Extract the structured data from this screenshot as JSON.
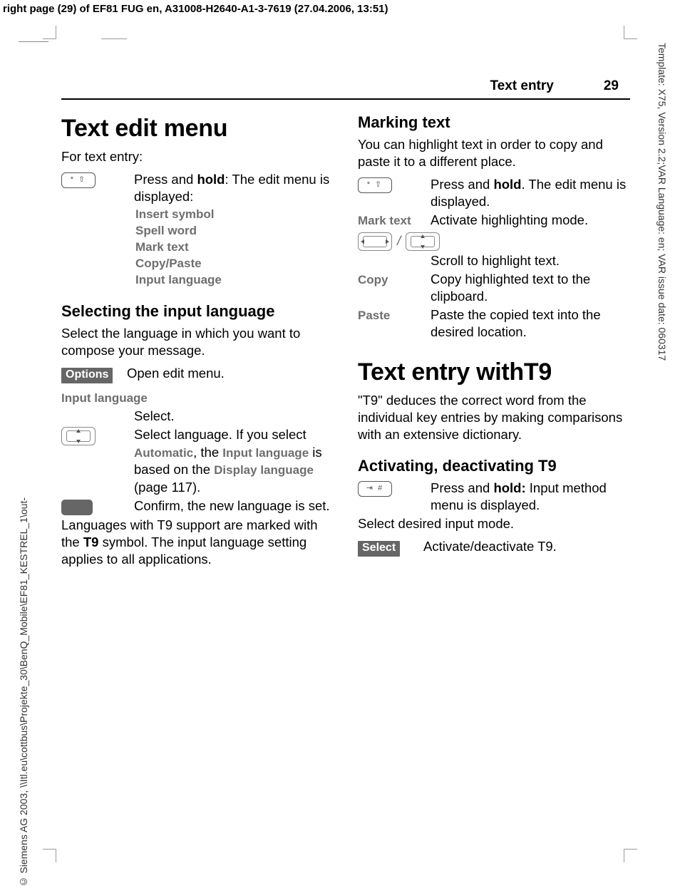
{
  "meta": {
    "top_header": "right page (29) of EF81 FUG en, A31008-H2640-A1-3-7619 (27.04.2006, 13:51)",
    "side_left": "© Siemens AG 2003, \\\\Itl.eu\\cottbus\\Projekte_30\\BenQ_Mobile\\EF81_KESTREL_1\\out-",
    "side_right": "Template: X75, Version 2.2;VAR Language: en; VAR issue date: 060317"
  },
  "running": {
    "section": "Text entry",
    "page": "29"
  },
  "left": {
    "h1": "Text edit menu",
    "intro": "For text entry:",
    "star_key": "*  ⇧",
    "press_hold_pre": "Press and ",
    "hold": "hold",
    "press_hold_post": ": The edit menu is displayed:",
    "menu": [
      "Insert symbol",
      "Spell word",
      "Mark text",
      "Copy/Paste",
      "Input language"
    ],
    "h2": "Selecting the input language",
    "select_lang": "Select the language in which you want to compose your message.",
    "options_softkey": "Options",
    "open_edit": "Open edit menu.",
    "input_lang_label": "Input language",
    "select": "Select.",
    "ud_desc_pre": "Select language. If you select ",
    "auto": "Automatic",
    "ud_desc_mid": ", the ",
    "il": "Input language",
    "ud_desc_mid2": " is based on the ",
    "dl": "Display language",
    "ud_desc_post": " (page 117).",
    "confirm": "Confirm, the new language is set.",
    "t9note_pre": "Languages with T9 support are marked with the ",
    "t9": "T9",
    "t9note_post": " symbol. The input language setting applies to all applications."
  },
  "right": {
    "h2a": "Marking text",
    "mark_intro": "You can highlight text in order to copy and paste it to a different place.",
    "star_key": "*  ⇧",
    "r_press_pre": "Press and ",
    "hold": "hold",
    "r_press_post": ". The edit menu is displayed.",
    "mark_text_label": "Mark text",
    "mark_text_desc": "Activate highlighting mode.",
    "scroll": "Scroll to highlight text.",
    "copy_label": "Copy",
    "copy_desc": "Copy highlighted text to the clipboard.",
    "paste_label": "Paste",
    "paste_desc": "Paste the copied text into the desired location.",
    "h1": "Text entry withT9",
    "t9_intro": "\"T9\" deduces the correct word from the individual key entries by making comparisons with an extensive dictionary.",
    "h2b": "Activating, deactivating T9",
    "hash_key": "⇥ #",
    "hash_pre": "Press and ",
    "hold2": "hold:",
    "hash_post": " Input method menu is displayed.",
    "select_mode": "Select desired input mode.",
    "select_softkey": "Select",
    "soft_desc": "Activate/deactivate T9."
  },
  "keys": {
    "slash": "/"
  }
}
